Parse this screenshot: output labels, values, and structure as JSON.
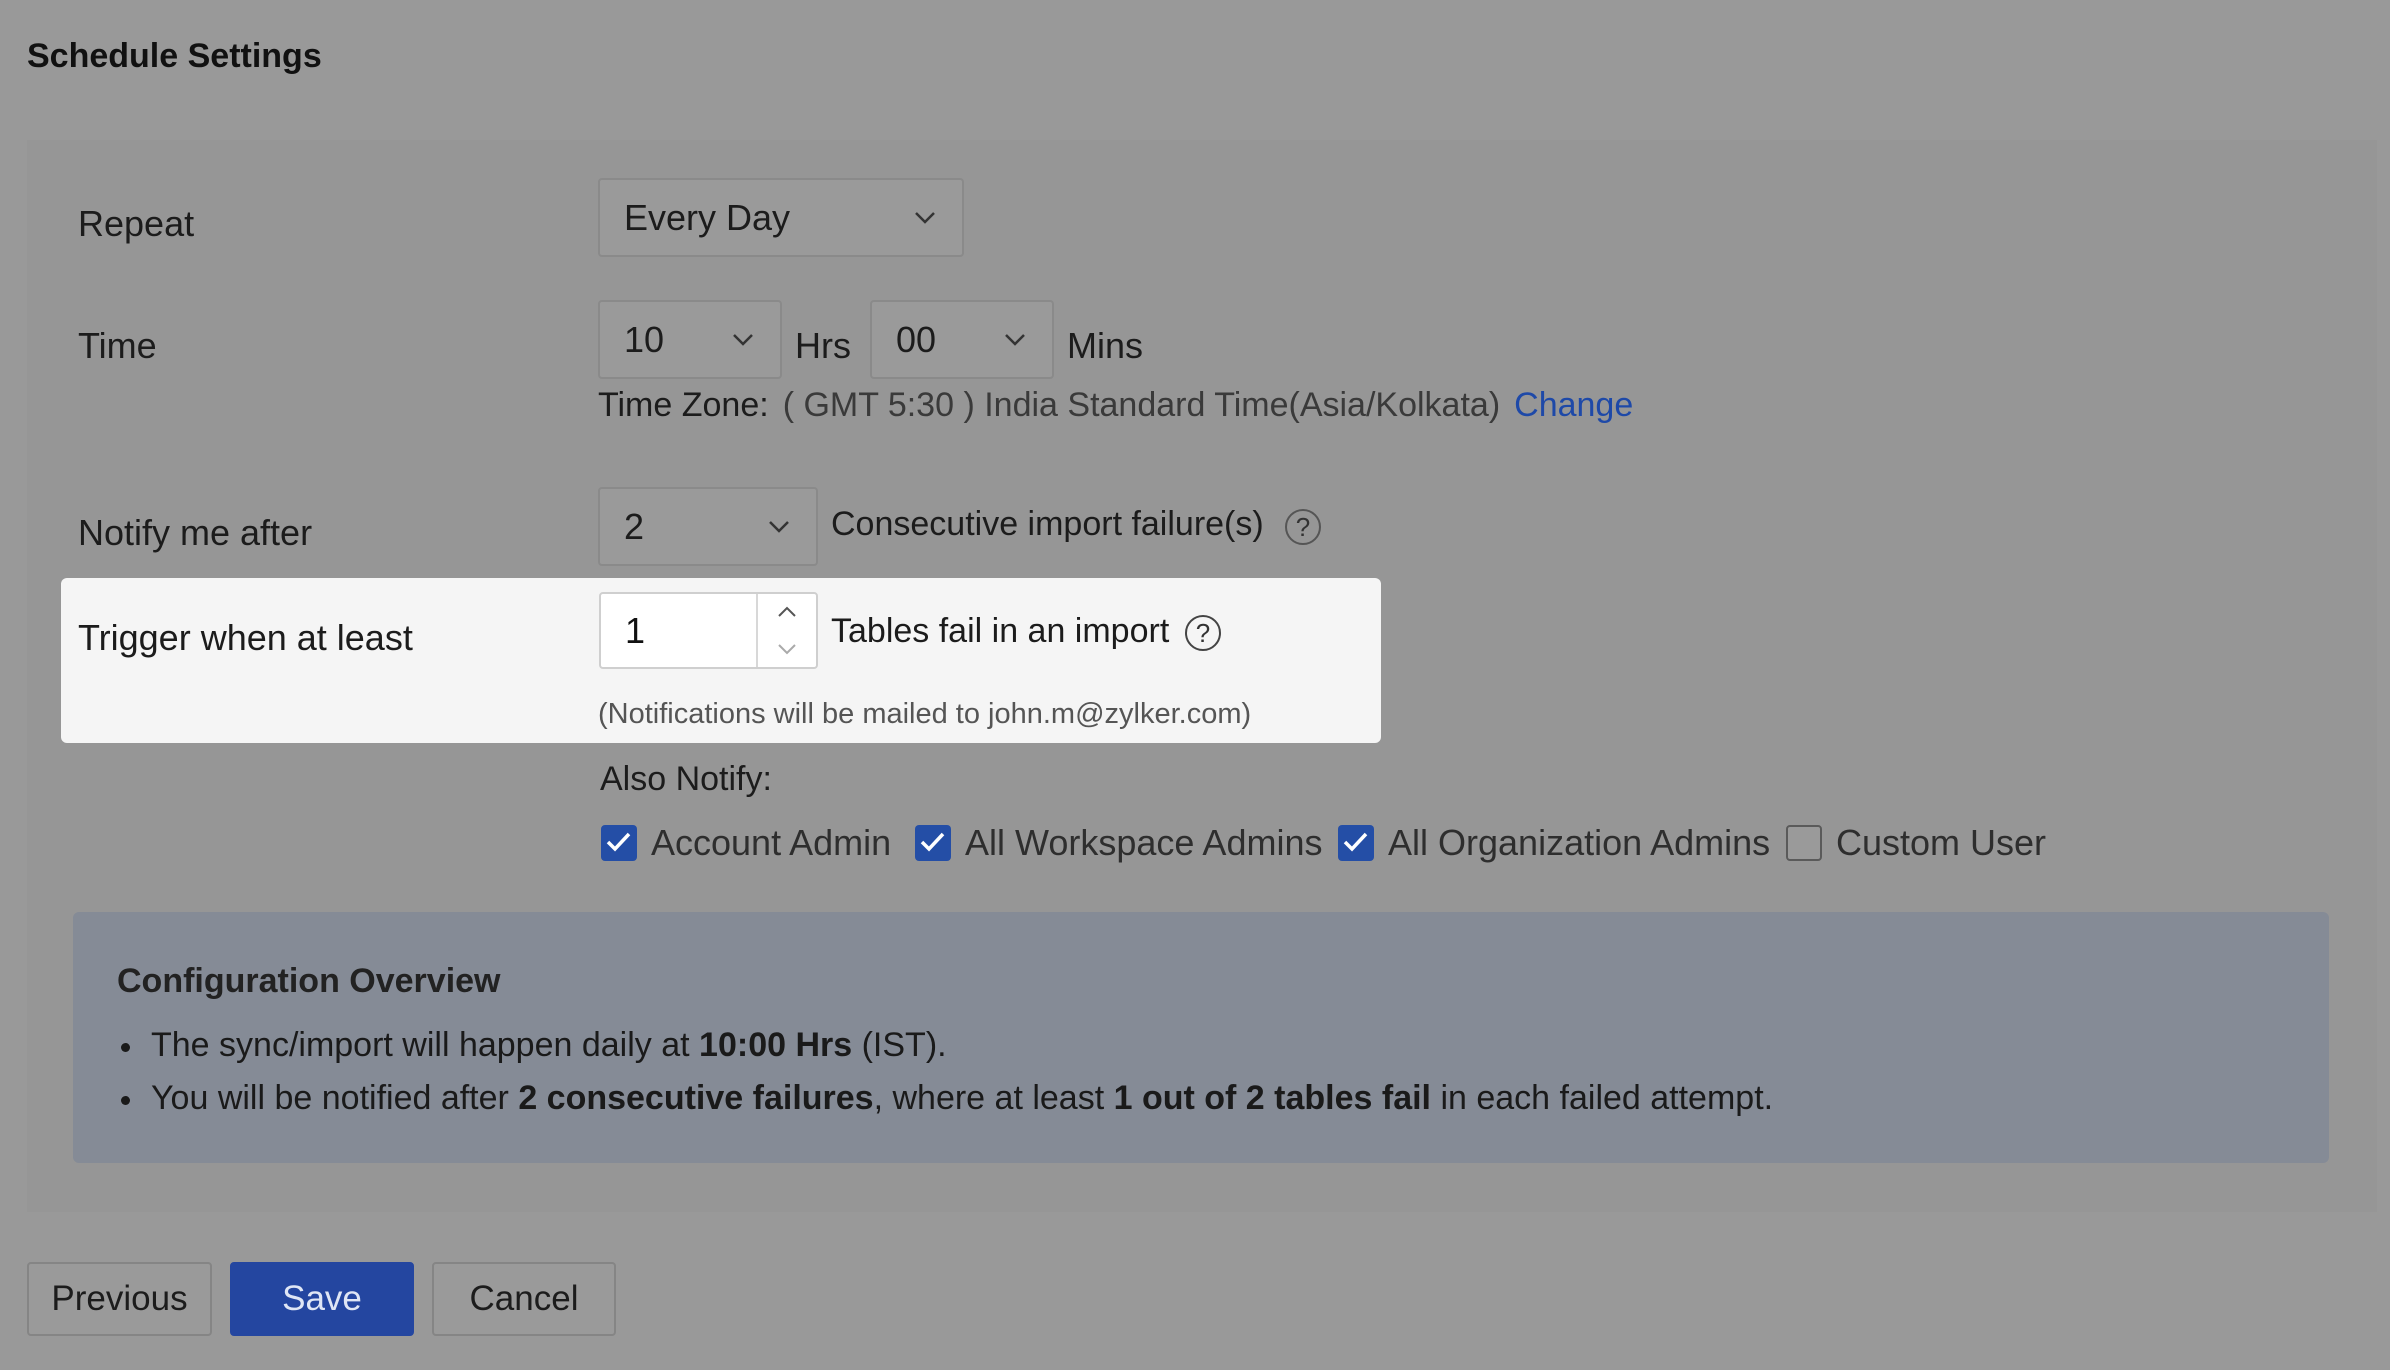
{
  "header": {
    "title": "Schedule Settings"
  },
  "repeat": {
    "label": "Repeat",
    "value": "Every Day"
  },
  "time": {
    "label": "Time",
    "hours_value": "10",
    "hours_unit": "Hrs",
    "mins_value": "00",
    "mins_unit": "Mins",
    "timezone_label": "Time Zone:",
    "timezone_value": "( GMT 5:30 ) India Standard Time(Asia/Kolkata)",
    "change_link": "Change"
  },
  "notify": {
    "label": "Notify me after",
    "value": "2",
    "suffix": "Consecutive import failure(s)",
    "help": "?"
  },
  "trigger": {
    "label": "Trigger when at least",
    "value": "1",
    "suffix": "Tables fail in an import",
    "help": "?",
    "note": "(Notifications will be mailed to john.m@zylker.com)"
  },
  "also_notify": {
    "label": "Also Notify:",
    "options": [
      {
        "label": "Account Admin",
        "checked": true
      },
      {
        "label": "All Workspace Admins",
        "checked": true
      },
      {
        "label": "All Organization Admins",
        "checked": true
      },
      {
        "label": "Custom User",
        "checked": false
      }
    ]
  },
  "overview": {
    "title": "Configuration Overview",
    "line1": {
      "a": "The sync/import will happen daily at ",
      "b": "10:00 Hrs",
      "c": " (IST)."
    },
    "line2": {
      "a": "You will be notified after ",
      "b": "2 consecutive failures",
      "c": ", where at least ",
      "d": "1 out of 2 tables fail",
      "e": " in each failed attempt."
    }
  },
  "buttons": {
    "previous": "Previous",
    "save": "Save",
    "cancel": "Cancel"
  },
  "colors": {
    "accent": "#2446a0",
    "link": "#1e49a8",
    "checkbox": "#244ea6"
  }
}
